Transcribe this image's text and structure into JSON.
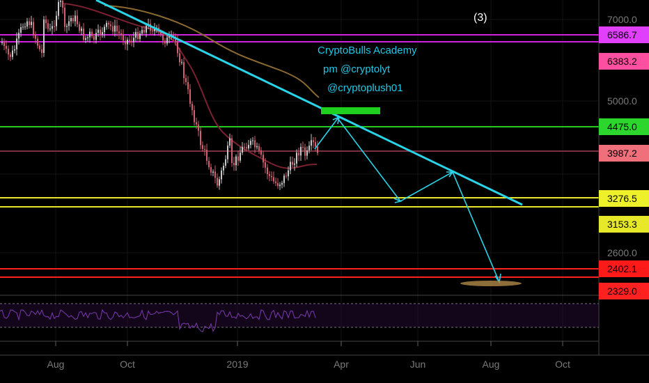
{
  "chart_data": {
    "type": "line",
    "title": "",
    "wave_marker": "(3)",
    "annotation": [
      "CryptoBulls Academy",
      "pm @cryptolyt",
      "@cryptoplush01"
    ],
    "x_ticks": [
      "Aug",
      "Oct",
      "2019",
      "Apr",
      "Jun",
      "Aug",
      "Oct"
    ],
    "y_ticks": [
      "7000.0",
      "5000.0",
      "2600.0"
    ],
    "price_labels": [
      {
        "id": "6586-7",
        "value": "6586.7",
        "bg": "#e040fb",
        "fg": "#000000"
      },
      {
        "id": "6383-2",
        "value": "6383.2",
        "bg": "#ff4fa0",
        "fg": "#000000"
      },
      {
        "id": "4475-0",
        "value": "4475.0",
        "bg": "#2cd62c",
        "fg": "#000000"
      },
      {
        "id": "3987-2",
        "value": "3987.2",
        "bg": "#ef6f7a",
        "fg": "#000000"
      },
      {
        "id": "3276-5",
        "value": "3276.5",
        "bg": "#eef02a",
        "fg": "#000000"
      },
      {
        "id": "3153-3",
        "value": "3153.3",
        "bg": "#e8e82a",
        "fg": "#000000"
      },
      {
        "id": "2402-1",
        "value": "2402.1",
        "bg": "#ff1a1a",
        "fg": "#000000"
      },
      {
        "id": "2329-0",
        "value": "2329.0",
        "bg": "#ff2020",
        "fg": "#000000"
      }
    ],
    "horizontal_levels": [
      {
        "value": 6586.7,
        "color": "#d020e0"
      },
      {
        "value": 6383.2,
        "color": "#d020e0"
      },
      {
        "value": 4475.0,
        "color": "#22cc22"
      },
      {
        "value": 3987.2,
        "color": "#7a3040"
      },
      {
        "value": 3276.5,
        "color": "#e6e62a"
      },
      {
        "value": 3153.3,
        "color": "#e6e62a"
      },
      {
        "value": 2402.1,
        "color": "#ff2020"
      },
      {
        "value": 2329.0,
        "color": "#ff2020"
      }
    ],
    "price_series_approx": [
      {
        "x": "2018-07-01",
        "y": 6500
      },
      {
        "x": "2018-07-20",
        "y": 7200
      },
      {
        "x": "2018-08-01",
        "y": 7600
      },
      {
        "x": "2018-08-15",
        "y": 6400
      },
      {
        "x": "2018-09-01",
        "y": 6900
      },
      {
        "x": "2018-09-15",
        "y": 6500
      },
      {
        "x": "2018-10-01",
        "y": 6600
      },
      {
        "x": "2018-10-20",
        "y": 6500
      },
      {
        "x": "2018-11-10",
        "y": 6400
      },
      {
        "x": "2018-11-20",
        "y": 4800
      },
      {
        "x": "2018-11-25",
        "y": 4000
      },
      {
        "x": "2018-12-15",
        "y": 3250
      },
      {
        "x": "2018-12-25",
        "y": 3900
      },
      {
        "x": "2019-01-10",
        "y": 3700
      },
      {
        "x": "2019-02-05",
        "y": 3400
      },
      {
        "x": "2019-02-25",
        "y": 3900
      },
      {
        "x": "2019-03-15",
        "y": 3950
      }
    ],
    "colors": {
      "trendline": "#2ad4e8",
      "projection": "#2ad4e8",
      "ma_brown": "#8a6a30",
      "ma_red": "#7a2030",
      "candles_up": "#c8c8c8",
      "candles_down": "#d06070",
      "green_box": "#1fd01f",
      "target_ellipse": "#b08a4a",
      "rsi": "#7a3ab0",
      "rsi_band": "#2a0a3a"
    }
  }
}
